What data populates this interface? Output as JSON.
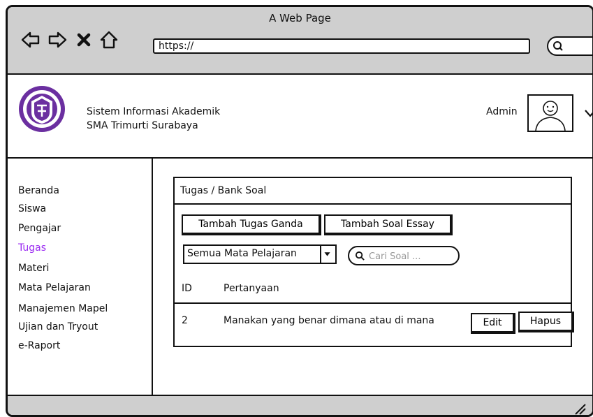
{
  "browser": {
    "title": "A Web Page",
    "url": "https://",
    "nav": [
      "back-icon",
      "forward-icon",
      "close-icon",
      "home-icon"
    ],
    "search_icon": "search-icon"
  },
  "header": {
    "school_name_line1": "Sistem Informasi Akademik",
    "school_name_line2": "SMA Trimurti Surabaya",
    "user_label": "Admin",
    "logo_icon": "school-logo",
    "avatar_icon": "user-avatar-icon",
    "menu_icon": "chevron-down-icon"
  },
  "sidebar": {
    "items": [
      {
        "label": "Beranda",
        "active": false
      },
      {
        "label": "Siswa",
        "active": false
      },
      {
        "label": "Pengajar",
        "active": false
      },
      {
        "label": "Tugas",
        "active": true
      },
      {
        "label": "Materi",
        "active": false
      },
      {
        "label": "Mata Pelajaran",
        "active": false
      },
      {
        "label": "Manajemen Mapel",
        "active": false
      },
      {
        "label": "Ujian dan Tryout",
        "active": false
      },
      {
        "label": "e-Raport",
        "active": false
      }
    ],
    "active_color": "#9b2bf2"
  },
  "main": {
    "breadcrumb": "Tugas / Bank Soal",
    "buttons": {
      "add_multiple_choice": "Tambah Tugas Ganda",
      "add_essay": "Tambah Soal Essay"
    },
    "filter": {
      "selected": "Semua Mata Pelajaran"
    },
    "search": {
      "placeholder": "Cari Soal ..."
    },
    "table": {
      "columns": [
        "ID",
        "Pertanyaan"
      ],
      "rows": [
        {
          "id": "2",
          "question": "Manakan yang benar dimana atau di mana",
          "edit_label": "Edit",
          "delete_label": "Hapus"
        }
      ]
    }
  },
  "colors": {
    "chrome": "#cfcfcf",
    "accent": "#9b2bf2",
    "logo": "#6b2fa0"
  }
}
